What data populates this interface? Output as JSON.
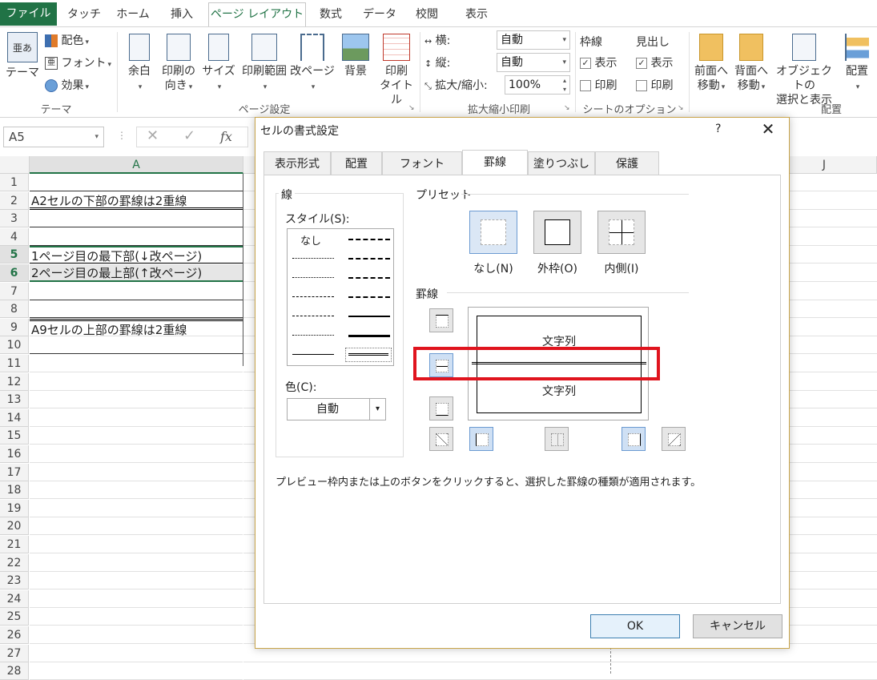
{
  "ribbon_tabs": [
    "ファイル",
    "タッチ",
    "ホーム",
    "挿入",
    "ページ レイアウト",
    "数式",
    "データ",
    "校閲",
    "表示"
  ],
  "ribbon": {
    "theme_btn": "テーマ",
    "colors": "配色",
    "fonts": "フォント",
    "effects": "効果",
    "theme_group": "テーマ",
    "margins": "余白",
    "orientation_1": "印刷の",
    "orientation_2": "向き",
    "size": "サイズ",
    "print_area": "印刷範囲",
    "breaks": "改ページ",
    "background": "背景",
    "print_titles_1": "印刷",
    "print_titles_2": "タイトル",
    "page_setup_group": "ページ設定",
    "width_label": "横:",
    "width_value": "自動",
    "height_label": "縦:",
    "height_value": "自動",
    "scale_label": "拡大/縮小:",
    "scale_value": "100%",
    "scale_group": "拡大縮小印刷",
    "gridlines": "枠線",
    "headings": "見出し",
    "view": "表示",
    "print": "印刷",
    "sheet_options_group": "シートのオプション",
    "bring_forward_1": "前面へ",
    "bring_forward_2": "移動",
    "send_backward_1": "背面へ",
    "send_backward_2": "移動",
    "selection_pane_1": "オブジェクトの",
    "selection_pane_2": "選択と表示",
    "align": "配置",
    "arrange_group": "配置"
  },
  "formula_bar": {
    "name_box": "A5",
    "fx": "fx"
  },
  "columns": {
    "A": "A",
    "J": "J"
  },
  "rows": [
    "1",
    "2",
    "3",
    "4",
    "5",
    "6",
    "7",
    "8",
    "9",
    "10",
    "11",
    "12",
    "13",
    "14",
    "15",
    "16",
    "17",
    "18",
    "19",
    "20",
    "21",
    "22",
    "23",
    "24",
    "25",
    "26",
    "27",
    "28"
  ],
  "cells": {
    "A2": "A2セルの下部の罫線は2重線",
    "A5": "1ページ目の最下部(↓改ページ)",
    "A6": "2ページ目の最上部(↑改ページ)",
    "A9": "A9セルの上部の罫線は2重線"
  },
  "dialog": {
    "title": "セルの書式設定",
    "help": "?",
    "close": "✕",
    "tabs": [
      "表示形式",
      "配置",
      "フォント",
      "罫線",
      "塗りつぶし",
      "保護"
    ],
    "line_section": "線",
    "style_label": "スタイル(S):",
    "style_none": "なし",
    "color_label": "色(C):",
    "color_value": "自動",
    "presets_section": "プリセット",
    "preset_none": "なし(N)",
    "preset_outline": "外枠(O)",
    "preset_inside": "内側(I)",
    "border_section": "罫線",
    "preview_text": "文字列",
    "hint": "プレビュー枠内または上のボタンをクリックすると、選択した罫線の種類が適用されます。",
    "ok": "OK",
    "cancel": "キャンセル"
  },
  "colors": {
    "accent": "#217346",
    "highlight_red": "#e0141e",
    "dialog_border": "#c9a44a"
  }
}
